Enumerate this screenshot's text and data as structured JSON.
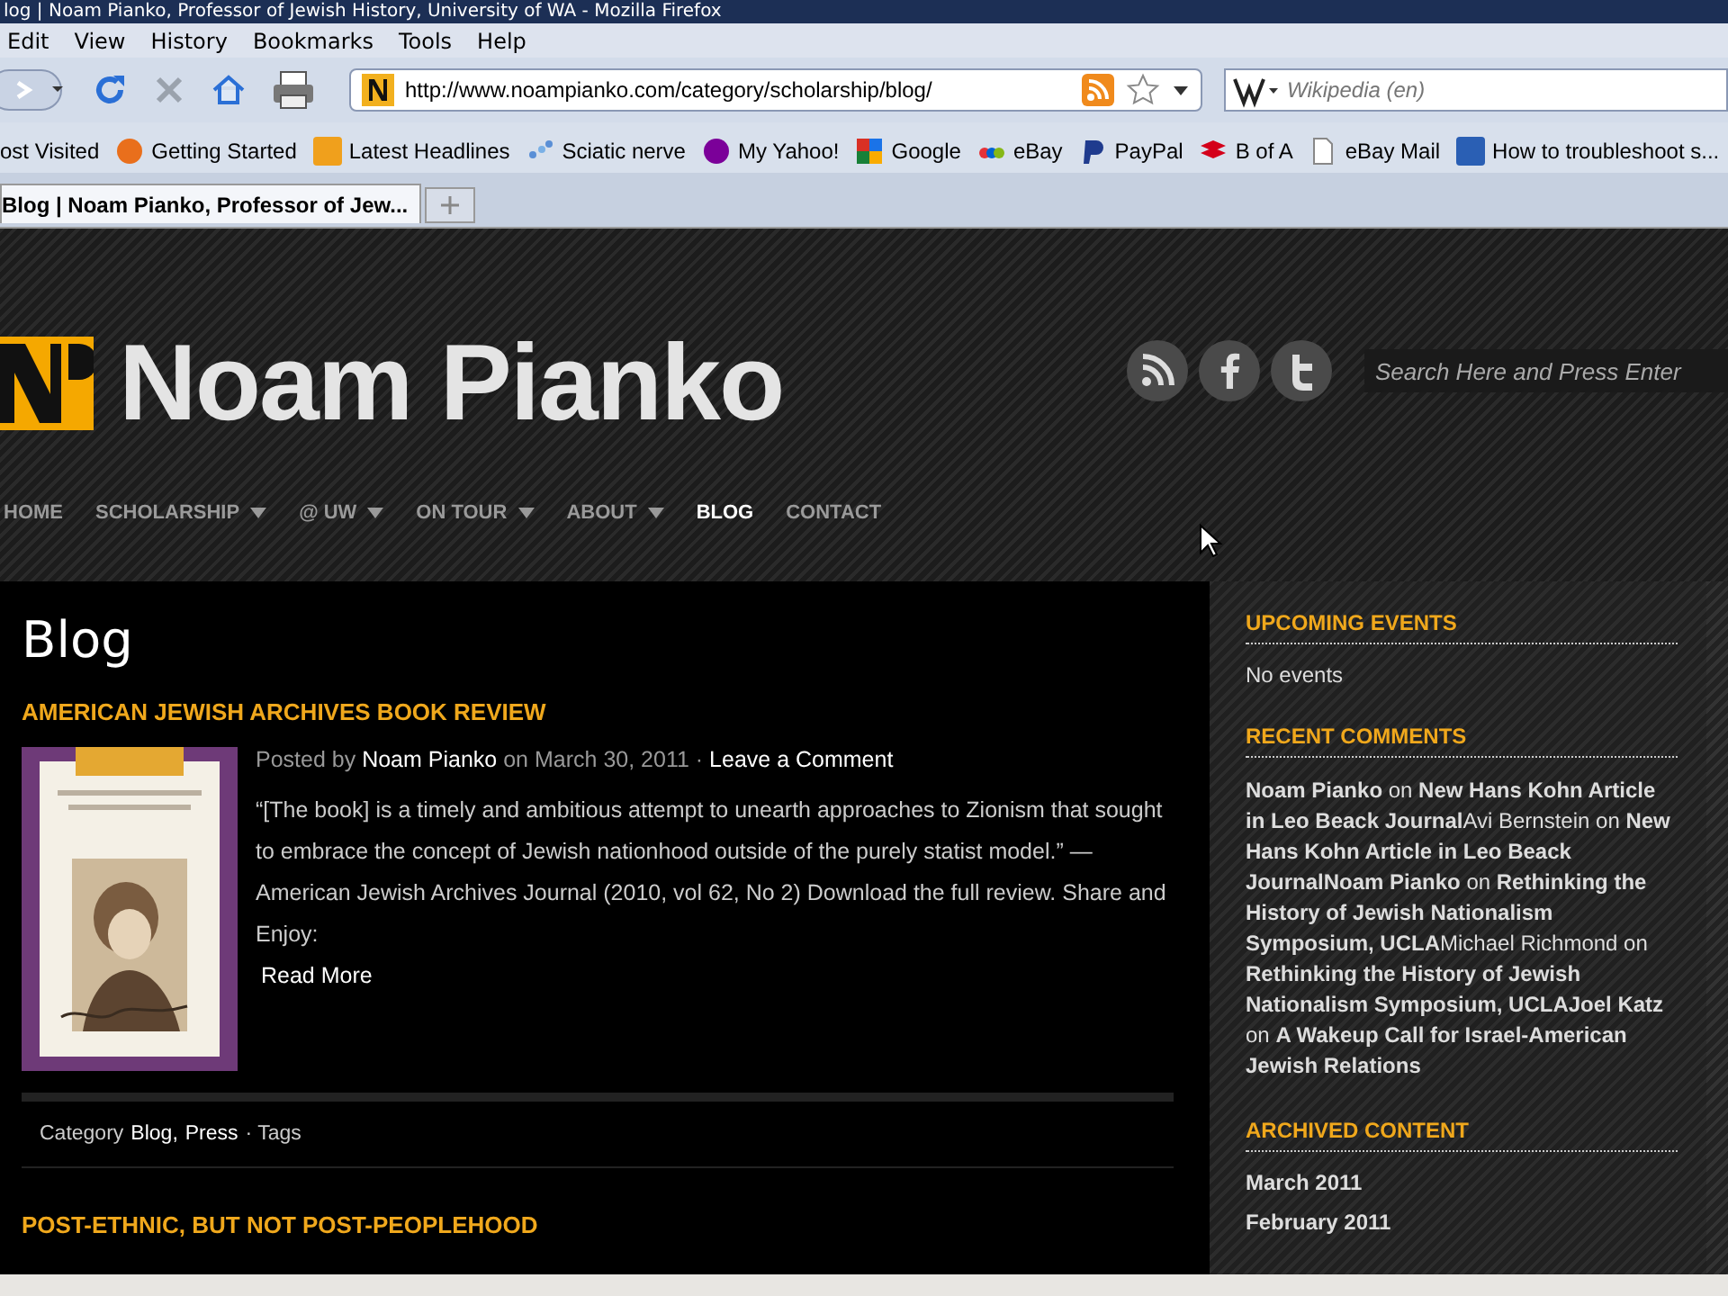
{
  "window": {
    "title": "log | Noam Pianko, Professor of Jewish History, University of WA - Mozilla Firefox"
  },
  "menu": [
    "Edit",
    "View",
    "History",
    "Bookmarks",
    "Tools",
    "Help"
  ],
  "address_bar": {
    "url": "http://www.noampianko.com/category/scholarship/blog/"
  },
  "search_bar": {
    "placeholder": "Wikipedia (en)"
  },
  "bookmarks": [
    {
      "label": "ost Visited",
      "kind": "none"
    },
    {
      "label": "Getting Started",
      "kind": "firefox"
    },
    {
      "label": "Latest Headlines",
      "kind": "rss"
    },
    {
      "label": "Sciatic nerve",
      "kind": "dots"
    },
    {
      "label": "My Yahoo!",
      "kind": "yahoo"
    },
    {
      "label": "Google",
      "kind": "google"
    },
    {
      "label": "eBay",
      "kind": "ebay"
    },
    {
      "label": "PayPal",
      "kind": "paypal"
    },
    {
      "label": "B of A",
      "kind": "flag"
    },
    {
      "label": "eBay Mail",
      "kind": "page"
    },
    {
      "label": "How to troubleshoot s...",
      "kind": "m"
    }
  ],
  "tabs": [
    {
      "label": "Blog | Noam Pianko, Professor of Jew...",
      "selected": true
    }
  ],
  "site": {
    "name": "Noam Pianko",
    "search_placeholder": "Search Here and Press Enter",
    "nav": [
      {
        "label": "HOME",
        "dropdown": false,
        "selected": false
      },
      {
        "label": "SCHOLARSHIP",
        "dropdown": true,
        "selected": false
      },
      {
        "label": "@ UW",
        "dropdown": true,
        "selected": false
      },
      {
        "label": "ON TOUR",
        "dropdown": true,
        "selected": false
      },
      {
        "label": "ABOUT",
        "dropdown": true,
        "selected": false
      },
      {
        "label": "BLOG",
        "dropdown": false,
        "selected": true
      },
      {
        "label": "CONTACT",
        "dropdown": false,
        "selected": false
      }
    ]
  },
  "main": {
    "heading": "Blog",
    "post": {
      "title": "AMERICAN JEWISH ARCHIVES BOOK REVIEW",
      "posted_by": "Posted by",
      "author": "Noam Pianko",
      "date": "on March 30, 2011 ·",
      "comment_link": "Leave a Comment",
      "excerpt": "“[The book] is a timely and ambitious attempt to unearth approaches to Zionism that sought to embrace the concept of Jewish nationhood outside of the purely statist model.” —American Jewish Archives Journal (2010, vol 62, No 2) Download the full review. Share and Enjoy:",
      "read_more": "Read More",
      "category_label": "Category",
      "categories": [
        "Blog,",
        "Press"
      ],
      "tags_label": "· Tags"
    },
    "next_post_title": "POST-ETHNIC, BUT NOT POST-PEOPLEHOOD"
  },
  "sidebar": {
    "events": {
      "title": "UPCOMING EVENTS",
      "text": "No events"
    },
    "comments": {
      "title": "RECENT COMMENTS",
      "items": [
        "**Noam Pianko** on **New Hans Kohn Article in Leo Beack Journal**",
        "Avi Bernstein on **New Hans Kohn Article in Leo Beack Journal**",
        "**Noam Pianko** on **Rethinking the History of Jewish Nationalism Symposium, UCLA**",
        "Michael Richmond on **Rethinking the History of Jewish Nationalism Symposium, UCLA**",
        "**Joel Katz** on **A Wakeup Call for Israel-American Jewish Relations**"
      ]
    },
    "archive": {
      "title": "ARCHIVED CONTENT",
      "items": [
        "March 2011",
        "February 2011"
      ]
    }
  }
}
